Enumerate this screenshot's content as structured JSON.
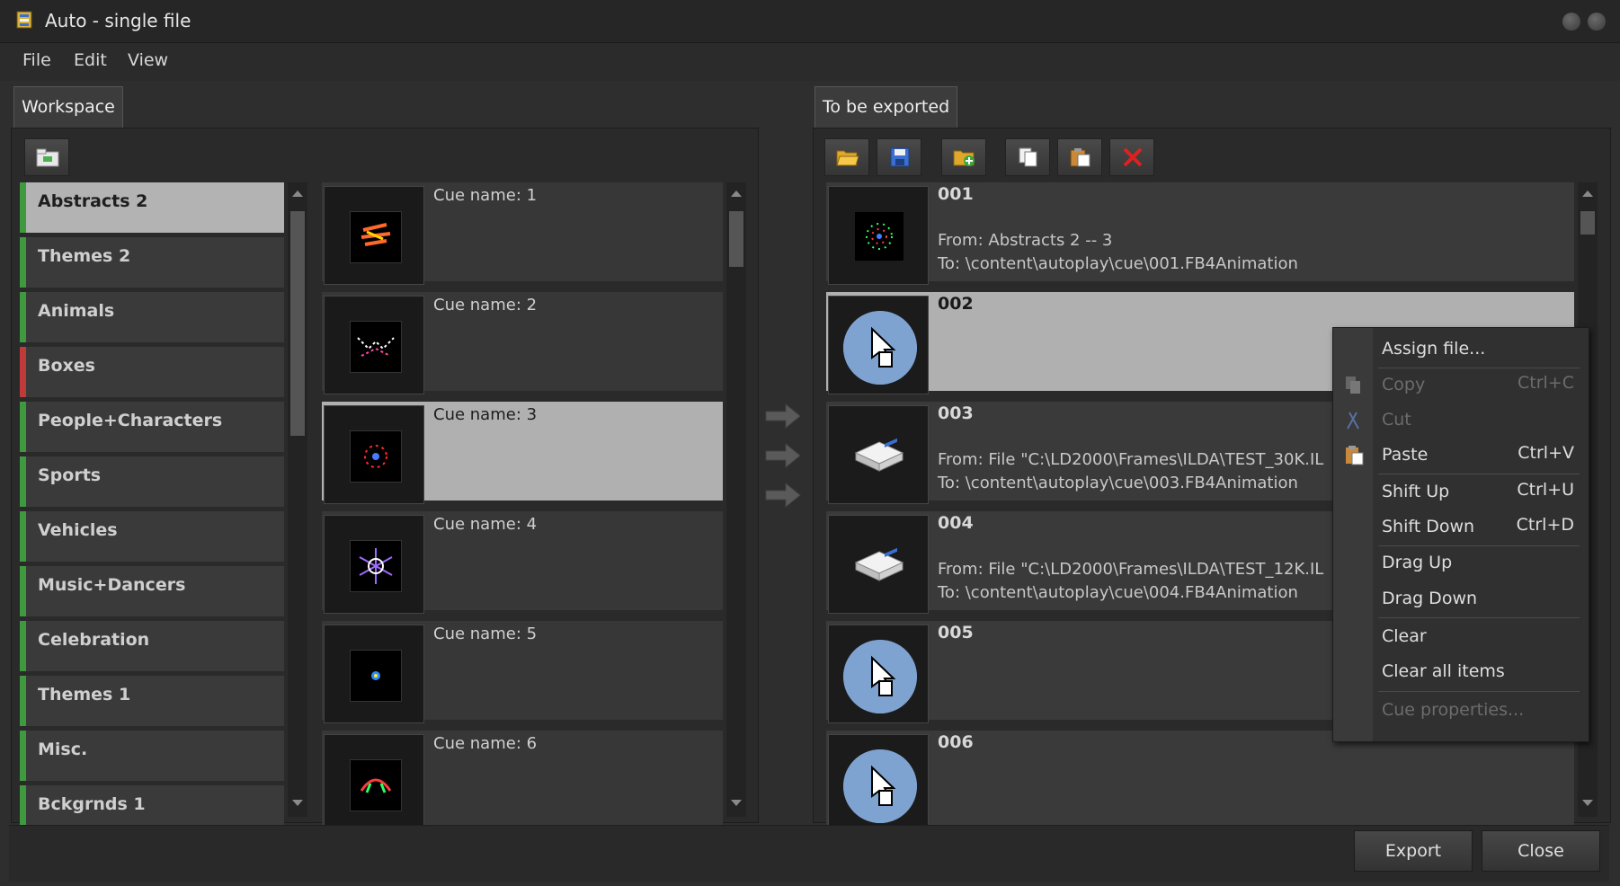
{
  "window": {
    "title": "Auto - single file"
  },
  "menu": [
    "File",
    "Edit",
    "View"
  ],
  "tabs": {
    "workspace": "Workspace",
    "export": "To be exported"
  },
  "categories": [
    {
      "label": "Abstracts 2",
      "color": "#3f9a3f",
      "selected": true
    },
    {
      "label": "Themes 2",
      "color": "#3f9a3f"
    },
    {
      "label": "Animals",
      "color": "#3f9a3f"
    },
    {
      "label": "Boxes",
      "color": "#c03a3a"
    },
    {
      "label": "People+Characters",
      "color": "#3f9a3f"
    },
    {
      "label": "Sports",
      "color": "#3f9a3f"
    },
    {
      "label": "Vehicles",
      "color": "#3f9a3f"
    },
    {
      "label": "Music+Dancers",
      "color": "#3f9a3f"
    },
    {
      "label": "Celebration",
      "color": "#3f9a3f"
    },
    {
      "label": "Themes 1",
      "color": "#3f9a3f"
    },
    {
      "label": "Misc.",
      "color": "#3f9a3f"
    },
    {
      "label": "Bckgrnds 1",
      "color": "#3f9a3f"
    }
  ],
  "cues": [
    {
      "name": "Cue name: 1"
    },
    {
      "name": "Cue name: 2"
    },
    {
      "name": "Cue name: 3",
      "selected": true
    },
    {
      "name": "Cue name: 4"
    },
    {
      "name": "Cue name: 5"
    },
    {
      "name": "Cue name: 6"
    }
  ],
  "export_items": [
    {
      "num": "001",
      "icon": "animation-preview",
      "from": "From: Abstracts 2 -- 3",
      "to": "To: \\content\\autoplay\\cue\\001.FB4Animation"
    },
    {
      "num": "002",
      "icon": "cursor-icon",
      "selected": true,
      "from": "",
      "to": ""
    },
    {
      "num": "003",
      "icon": "drive-icon",
      "from": "From: File \"C:\\LD2000\\Frames\\ILDA\\TEST_30K.IL",
      "to": "To: \\content\\autoplay\\cue\\003.FB4Animation"
    },
    {
      "num": "004",
      "icon": "drive-icon",
      "from": "From: File \"C:\\LD2000\\Frames\\ILDA\\TEST_12K.IL",
      "to": "To: \\content\\autoplay\\cue\\004.FB4Animation"
    },
    {
      "num": "005",
      "icon": "cursor-icon",
      "from": "",
      "to": ""
    },
    {
      "num": "006",
      "icon": "cursor-icon",
      "from": "",
      "to": ""
    }
  ],
  "context_menu": {
    "assign": "Assign file...",
    "copy": "Copy",
    "copy_sc": "Ctrl+C",
    "cut": "Cut",
    "paste": "Paste",
    "paste_sc": "Ctrl+V",
    "shift_up": "Shift Up",
    "shift_up_sc": "Ctrl+U",
    "shift_down": "Shift Down",
    "shift_down_sc": "Ctrl+D",
    "drag_up": "Drag Up",
    "drag_down": "Drag Down",
    "clear": "Clear",
    "clear_all": "Clear all items",
    "cue_props": "Cue properties..."
  },
  "buttons": {
    "export": "Export",
    "close": "Close"
  }
}
